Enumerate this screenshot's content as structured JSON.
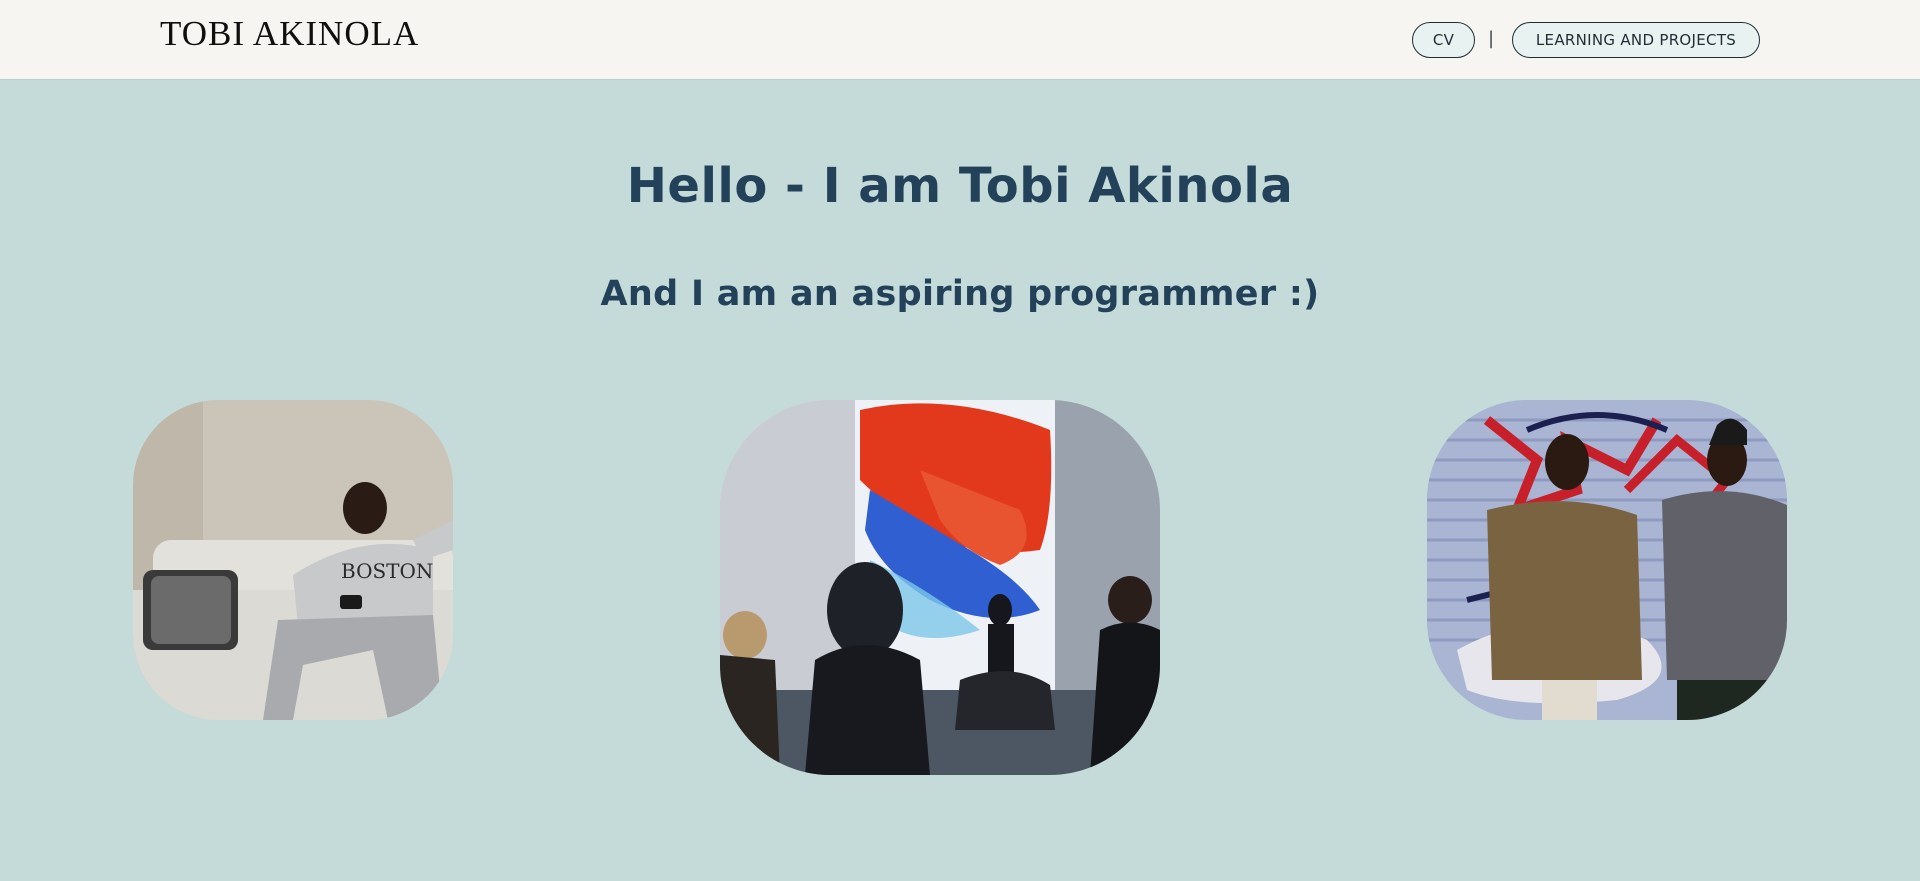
{
  "header": {
    "logo": "TOBI AKINOLA",
    "nav": {
      "cv_label": "CV",
      "separator": "|",
      "projects_label": "LEARNING AND PROJECTS"
    }
  },
  "hero": {
    "title": "Hello - I am Tobi Akinola",
    "subtitle": "And I am an aspiring programmer :)"
  },
  "photos": [
    {
      "subject": "man-on-sofa-photo",
      "sweatshirt_text": "BOSTON"
    },
    {
      "subject": "gallery-art-display-photo"
    },
    {
      "subject": "two-men-graffiti-wall-photo"
    }
  ],
  "colors": {
    "page_background": "#c4dbda",
    "header_background": "#f6f5f1",
    "heading_color": "#234159",
    "pill_background": "#e8f2f1"
  }
}
